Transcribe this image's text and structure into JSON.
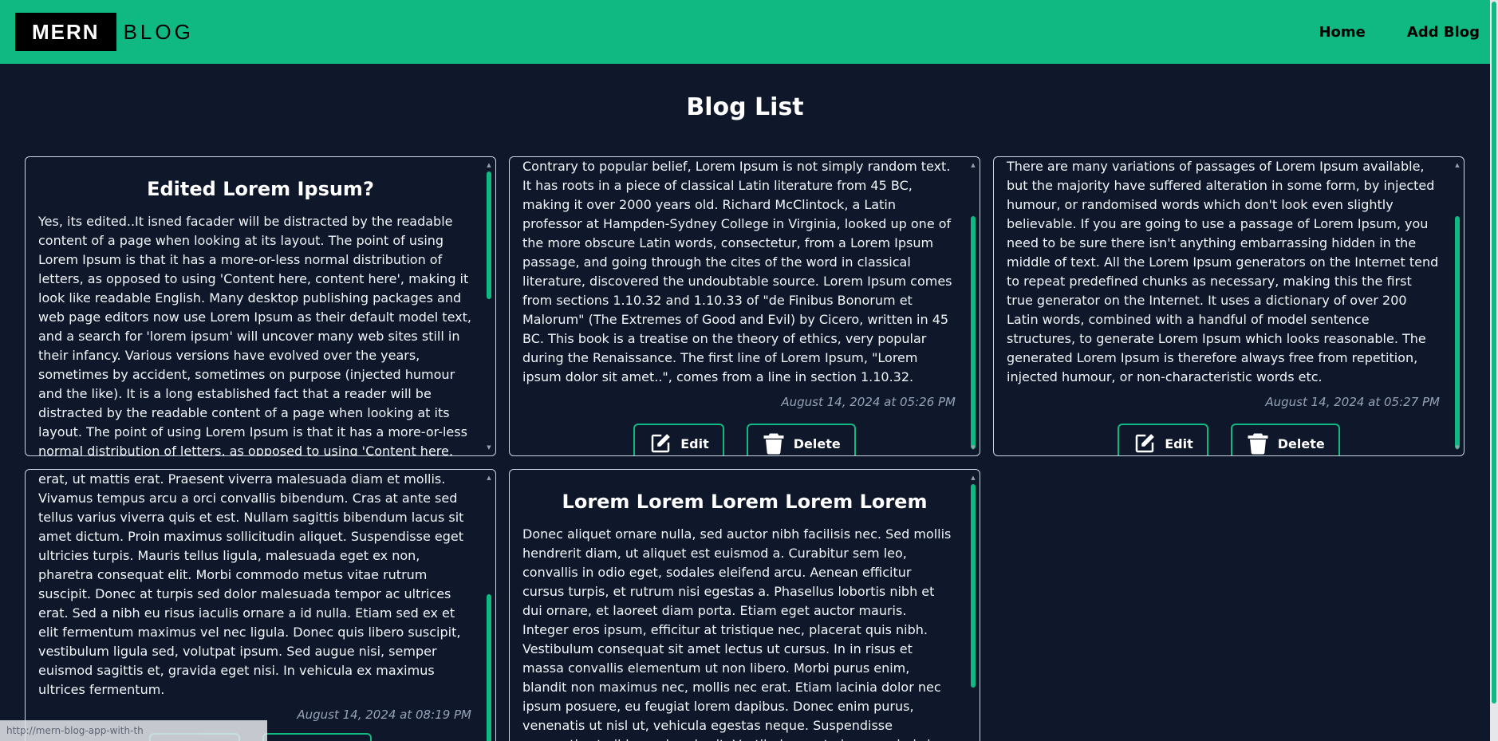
{
  "header": {
    "logo_main": "MERN",
    "logo_sub": "BLOG",
    "nav": [
      "Home",
      "Add Blog"
    ]
  },
  "page": {
    "title": "Blog List"
  },
  "buttons": {
    "edit": "Edit",
    "delete": "Delete"
  },
  "cards": [
    {
      "title": "Edited Lorem Ipsum?",
      "body": "Yes, its edited..It isned facader will be distracted by the readable content of a page when looking at its layout. The point of using Lorem Ipsum is that it has a more-or-less normal distribution of letters, as opposed to using 'Content here, content here', making it look like readable English. Many desktop publishing packages and web page editors now use Lorem Ipsum as their default model text, and a search for 'lorem ipsum' will uncover many web sites still in their infancy. Various versions have evolved over the years, sometimes by accident, sometimes on purpose (injected humour and the like). It is a long established fact that a reader will be distracted by the readable content of a page when looking at its layout. The point of using Lorem Ipsum is that it has a more-or-less normal distribution of letters, as opposed to using 'Content here, content here', making it look like readable English. Many desktop publishing"
    },
    {
      "body": "Contrary to popular belief, Lorem Ipsum is not simply random text. It has roots in a piece of classical Latin literature from 45 BC, making it over 2000 years old. Richard McClintock, a Latin professor at Hampden-Sydney College in Virginia, looked up one of the more obscure Latin words, consectetur, from a Lorem Ipsum passage, and going through the cites of the word in classical literature, discovered the undoubtable source. Lorem Ipsum comes from sections 1.10.32 and 1.10.33 of \"de Finibus Bonorum et Malorum\" (The Extremes of Good and Evil) by Cicero, written in 45 BC. This book is a treatise on the theory of ethics, very popular during the Renaissance. The first line of Lorem Ipsum, \"Lorem ipsum dolor sit amet..\", comes from a line in section 1.10.32.",
      "date": "August 14, 2024 at 05:26 PM"
    },
    {
      "body": "There are many variations of passages of Lorem Ipsum available, but the majority have suffered alteration in some form, by injected humour, or randomised words which don't look even slightly believable. If you are going to use a passage of Lorem Ipsum, you need to be sure there isn't anything embarrassing hidden in the middle of text. All the Lorem Ipsum generators on the Internet tend to repeat predefined chunks as necessary, making this the first true generator on the Internet. It uses a dictionary of over 200 Latin words, combined with a handful of model sentence structures, to generate Lorem Ipsum which looks reasonable. The generated Lorem Ipsum is therefore always free from repetition, injected humour, or non-characteristic words etc.",
      "date": "August 14, 2024 at 05:27 PM"
    },
    {
      "body": "erat, ut mattis erat. Praesent viverra malesuada diam et mollis. Vivamus tempus arcu a orci convallis bibendum. Cras at ante sed tellus varius viverra quis et est. Nullam sagittis bibendum lacus sit amet dictum. Proin maximus sollicitudin aliquet. Suspendisse eget ultricies turpis. Mauris tellus ligula, malesuada eget ex non, pharetra consequat elit. Morbi commodo metus vitae rutrum suscipit. Donec at turpis sed dolor malesuada tempor ac ultrices erat. Sed a nibh eu risus iaculis ornare a id nulla. Etiam sed ex et elit fermentum maximus vel nec ligula. Donec quis libero suscipit, vestibulum ligula sed, volutpat ipsum. Sed augue nisi, semper euismod sagittis et, gravida eget nisi. In vehicula ex maximus ultrices fermentum.",
      "date": "August 14, 2024 at 08:19 PM"
    },
    {
      "title": "Lorem Lorem Lorem Lorem Lorem",
      "body": "Donec aliquet ornare nulla, sed auctor nibh facilisis nec. Sed mollis hendrerit diam, ut aliquet est euismod a. Curabitur sem leo, convallis in odio eget, sodales eleifend arcu. Aenean efficitur cursus turpis, et rutrum nisi egestas a. Phasellus lobortis nibh et dui ornare, et laoreet diam porta. Etiam eget auctor mauris. Integer eros ipsum, efficitur at tristique nec, placerat quis nibh. Vestibulum consequat sit amet lectus ut cursus. In in risus et massa convallis elementum ut non libero. Morbi purus enim, blandit non maximus nec, mollis nec erat. Etiam lacinia dolor nec ipsum posuere, eu feugiat lorem dapibus. Donec enim purus, venenatis ut nisl ut, vehicula egestas neque. Suspendisse venenatis at nibh non hendrerit. Vestibulum ante ipsum primis in faucibus orci luctus et ultrices posuere"
    }
  ],
  "status_bar": {
    "url": "http://mern-blog-app-with-th"
  },
  "colors": {
    "accent": "#10b981",
    "background": "#0f172a",
    "date": "#94a3b8"
  }
}
